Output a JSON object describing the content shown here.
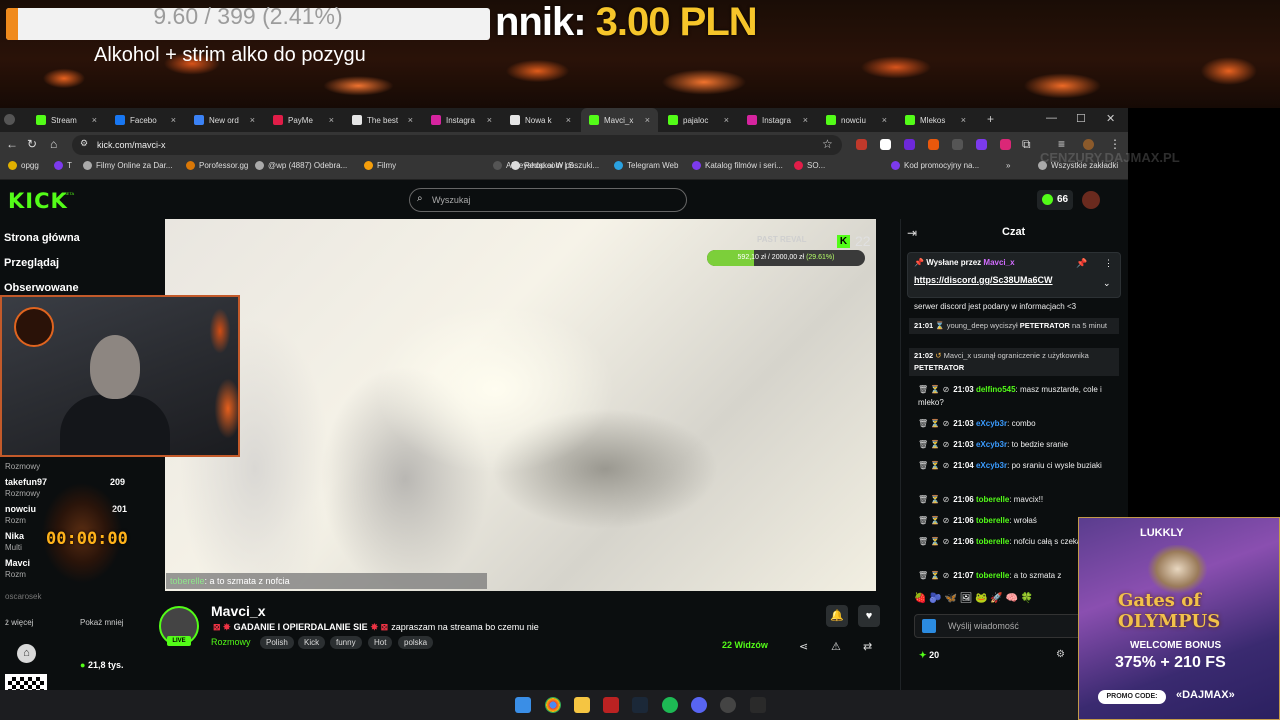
{
  "overlay": {
    "goal_text": "9.60 / 399 (2.41%)",
    "goal_progress": 0.0241,
    "goal_title": "Alkohol + strim alko do pozygu",
    "amount_label": "nnik:",
    "amount_value": "3.00 PLN",
    "watermark": "CENZURY.DAJMAX.PL"
  },
  "browser": {
    "tabs": [
      {
        "label": "Stream",
        "color": "#53fc18"
      },
      {
        "label": "Facebo",
        "color": "#1877f2"
      },
      {
        "label": "New ord",
        "color": "#3b82f6"
      },
      {
        "label": "PayMe",
        "color": "#e11d48"
      },
      {
        "label": "The best",
        "color": "#e5e5e5"
      },
      {
        "label": "Instagra",
        "color": "#d6249f"
      },
      {
        "label": "Nowa k",
        "color": "#e5e5e5"
      },
      {
        "label": "Mavci_x",
        "color": "#53fc18",
        "active": true
      },
      {
        "label": "pajaloc",
        "color": "#53fc18"
      },
      {
        "label": "Instagra",
        "color": "#d6249f"
      },
      {
        "label": "nowciu",
        "color": "#53fc18"
      },
      {
        "label": "Mlekos",
        "color": "#53fc18"
      }
    ],
    "close_glyph": "×",
    "new_tab": "+",
    "url": "kick.com/mavci-x",
    "bookmarks": [
      "opgg",
      "T",
      "Filmy Online za Dar...",
      "Porofessor.gg",
      "@wp (4887) Odebra...",
      "Filmy",
      "Allkeyshop.com | S...",
      "Redakai W poszuki...",
      "Telegram Web",
      "Katalog filmów i seri...",
      "SO...",
      "Kod promocyjny na...",
      "»",
      "Wszystkie zakładki"
    ]
  },
  "kick": {
    "logo": "KICK",
    "beta": "BETA",
    "search_placeholder": "Wyszukaj",
    "points": "66",
    "nav": [
      "Strona główna",
      "Przeglądaj",
      "Obserwowane"
    ],
    "side": {
      "section": "Rozmowy",
      "channels": [
        {
          "name": "takefun97",
          "cat": "Rozmowy",
          "count": "209"
        },
        {
          "name": "nowciu",
          "cat": "Rozm",
          "count": "201"
        },
        {
          "name": "Nika",
          "cat": "Multi",
          "count": ""
        },
        {
          "name": "Mavci",
          "cat": "Rozm",
          "count": ""
        },
        {
          "name": "oscarosek",
          "cat": "",
          "count": ""
        }
      ],
      "more": "ż więcej",
      "less": "Pokaż mniej",
      "followers": "21,8 tys."
    },
    "timer": "00:00:00",
    "video": {
      "goal_label": "PAST REVAL",
      "goal_text_a": "592,10 zł",
      "goal_text_b": "2000,00 zł",
      "goal_pct": "(29.61%)",
      "goal_progress": 0.2961,
      "k_badge": "K",
      "k_count": "22",
      "caption_user": "toberelle",
      "caption_text": ": a to szmata z nofcia"
    },
    "stream": {
      "live": "LIVE",
      "name": "Mavci_x",
      "title": "GADANIE I OPIERDALANIE SIE",
      "title_b": "zapraszam na streama bo czemu nie",
      "category": "Rozmowy",
      "tags": [
        "Polish",
        "Kick",
        "funny",
        "Hot",
        "polska"
      ],
      "viewers": "22 Widzów"
    },
    "chat": {
      "title": "Czat",
      "pinned_by": "Wysłane przez",
      "pinned_user": "Mavci_x",
      "pinned_link": "https://discord.gg/Sc38UMa6CW",
      "pinned_text": "serwer discord jest podany w informacjach <3",
      "sys1": {
        "time": "21:01",
        "user": "young_deep",
        "action": "wyciszył",
        "target": "PETETRATOR",
        "rest": "na 5 minut"
      },
      "sys2": {
        "time": "21:02",
        "user": "Mavci_x",
        "action": "usunął ograniczenie z użytkownika",
        "target": "PETETRATOR"
      },
      "messages": [
        {
          "time": "21:03",
          "user": "delfino545",
          "color": "green",
          "text": "masz musztarde, cole i mleko?"
        },
        {
          "time": "21:03",
          "user": "eXcyb3r",
          "color": "blue",
          "text": "combo"
        },
        {
          "time": "21:03",
          "user": "eXcyb3r",
          "color": "blue",
          "text": "to bedzie sranie"
        },
        {
          "time": "21:04",
          "user": "eXcyb3r",
          "color": "blue",
          "text": "po sraniu ci wysle buziaki"
        },
        {
          "time": "21:06",
          "user": "toberelle",
          "color": "green",
          "text": "mavcix!!"
        },
        {
          "time": "21:06",
          "user": "toberelle",
          "color": "green",
          "text": "wrołaś"
        },
        {
          "time": "21:06",
          "user": "toberelle",
          "color": "green",
          "text": "nofciu całą s czekał na ciebie"
        },
        {
          "time": "21:07",
          "user": "toberelle",
          "color": "green",
          "text": "a to szmata z"
        }
      ],
      "input_placeholder": "Wyślij wiadomość",
      "points": "20"
    }
  },
  "ad": {
    "brand": "LUKKLY",
    "game": "Gates of OLYMPUS",
    "welcome": "WELCOME BONUS",
    "bonus": "375% + 210 FS",
    "promo_label": "PROMO CODE:",
    "promo_code": "«DAJMAX»"
  }
}
